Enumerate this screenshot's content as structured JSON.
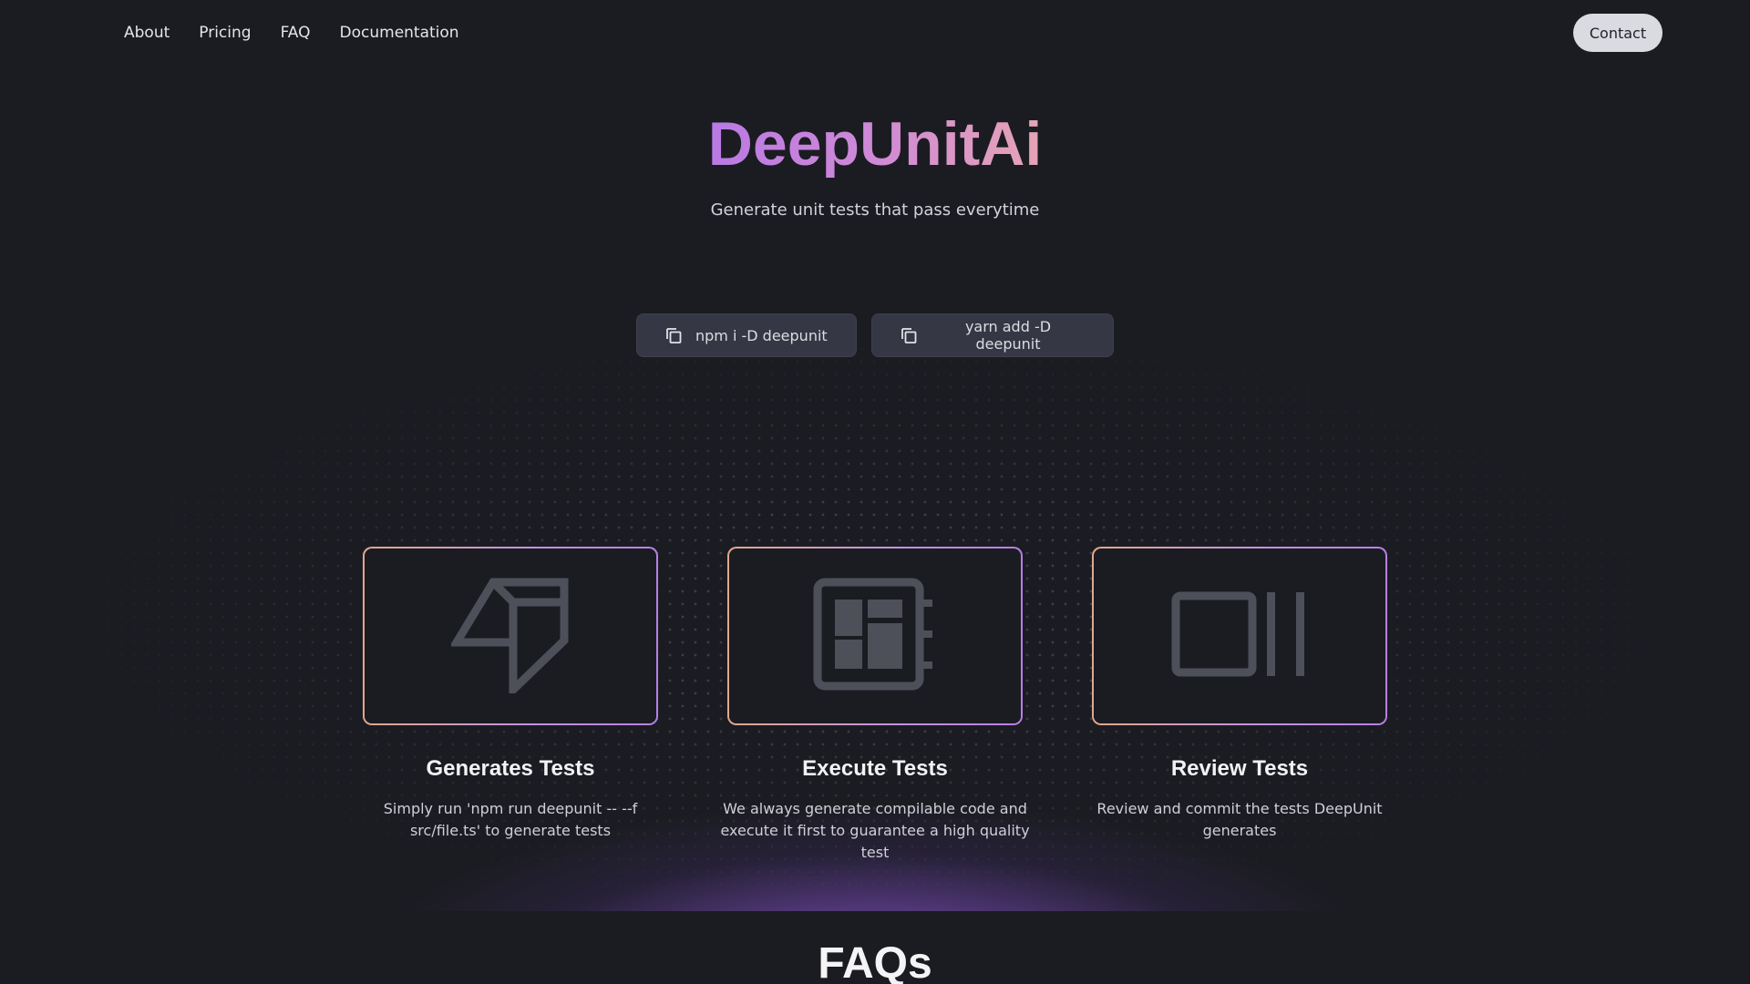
{
  "nav": {
    "items": [
      {
        "label": "About"
      },
      {
        "label": "Pricing"
      },
      {
        "label": "FAQ"
      },
      {
        "label": "Documentation"
      }
    ],
    "contact_label": "Contact"
  },
  "hero": {
    "title": "DeepUnitAi",
    "subtitle": "Generate unit tests that pass everytime"
  },
  "install": {
    "npm_command": "npm i -D deepunit",
    "yarn_command": "yarn add -D deepunit",
    "icon": "copy-icon"
  },
  "features": [
    {
      "icon": "arrow-forward-icon",
      "title": "Generates Tests",
      "description": "Simply run 'npm run deepunit -- --f src/file.ts' to generate tests"
    },
    {
      "icon": "dashboard-panel-icon",
      "title": "Execute Tests",
      "description": "We always generate compilable code and execute it first to guarantee a high quality test"
    },
    {
      "icon": "review-pause-icon",
      "title": "Review Tests",
      "description": "Review and commit the tests DeepUnit generates"
    }
  ],
  "faq": {
    "title": "FAQs"
  },
  "colors": {
    "background": "#1b1c22",
    "accent_start": "#b979e4",
    "accent_end": "#e6a4b4",
    "glow": "#784eaa",
    "button_bg": "#353844",
    "contact_bg": "#d9dbe1"
  }
}
